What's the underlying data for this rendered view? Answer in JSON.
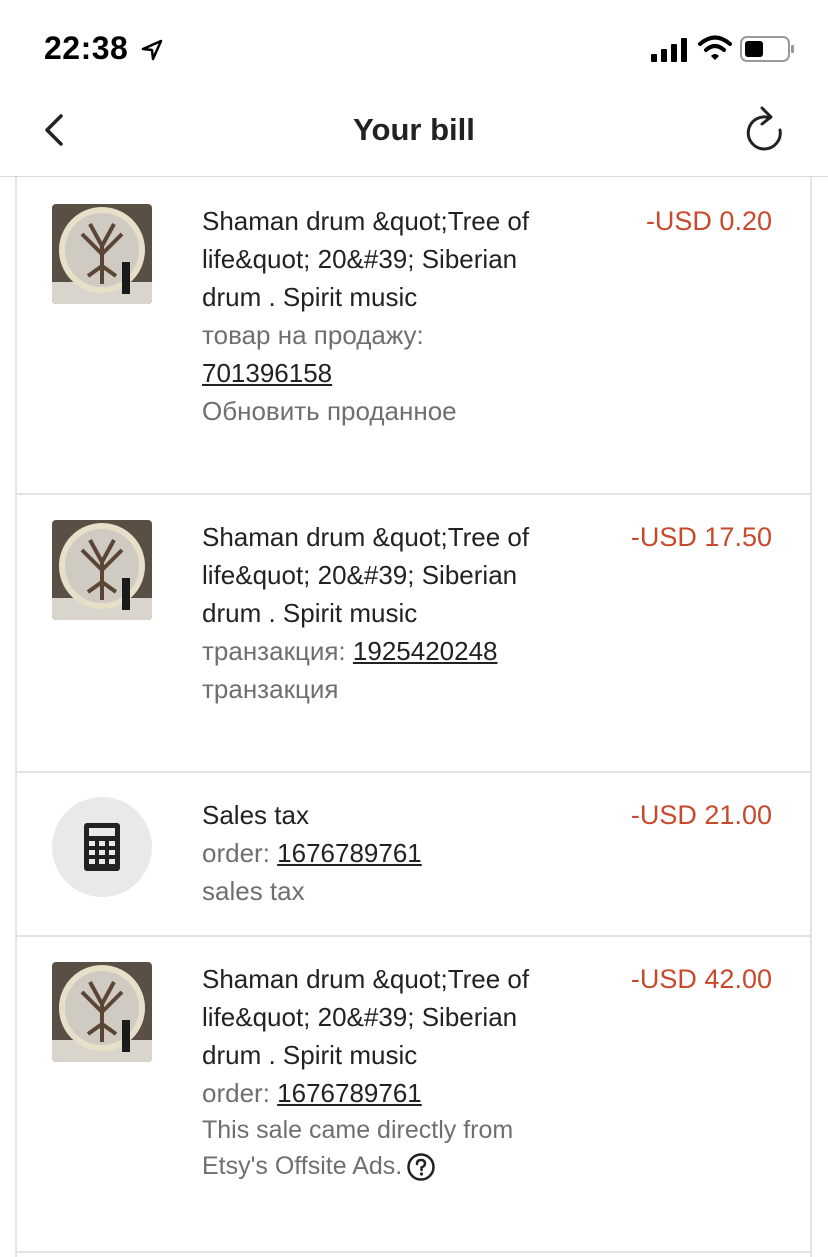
{
  "status_bar": {
    "time": "22:38"
  },
  "nav": {
    "title": "Your bill"
  },
  "items": [
    {
      "title": "Shaman drum &quot;Tree of life&quot; 20&#39; Siberian drum . Spirit music",
      "ref_label": "товар на продажу:",
      "ref_value": "701396158",
      "detail": "Обновить проданное",
      "amount": "-USD 0.20"
    },
    {
      "title": "Shaman drum &quot;Tree of life&quot; 20&#39; Siberian drum . Spirit music",
      "ref_label": "транзакция:",
      "ref_value": "1925420248",
      "detail": "транзакция",
      "amount": "-USD 17.50"
    },
    {
      "title": "Sales tax",
      "ref_label": "order:",
      "ref_value": "1676789761",
      "detail": "sales tax",
      "amount": "-USD 21.00"
    },
    {
      "title": "Shaman drum &quot;Tree of life&quot; 20&#39; Siberian drum . Spirit music",
      "ref_label": "order:",
      "ref_value": "1676789761",
      "detail": "This sale came directly from Etsy's Offsite Ads.",
      "amount": "-USD 42.00"
    }
  ],
  "colors": {
    "amount": "#c64a2b",
    "meta_text": "#6f6f6f",
    "divider": "#e3e3e3"
  }
}
